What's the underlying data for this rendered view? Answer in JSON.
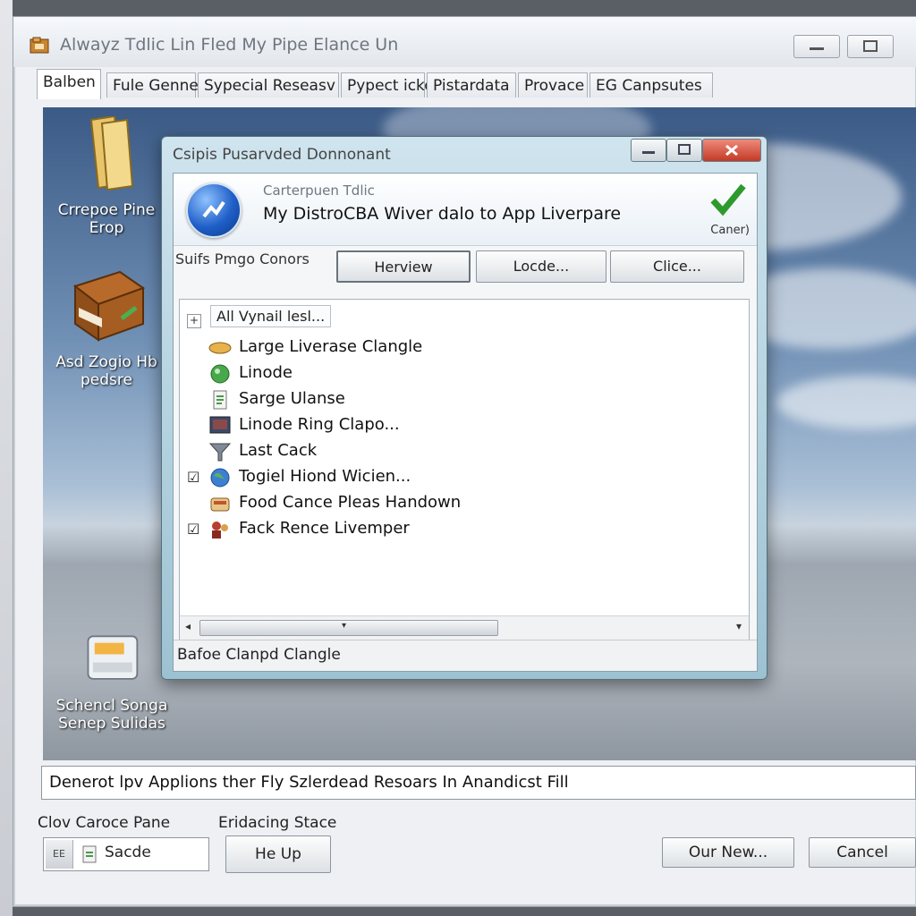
{
  "window": {
    "title": "Alwayz Tdlic Lin Fled My Pipe Elance Un",
    "tabs": [
      {
        "label": "Balben"
      },
      {
        "label": "Fule Genner"
      },
      {
        "label": "Sypecial Reseasv"
      },
      {
        "label": "Pypect icke"
      },
      {
        "label": "Pistardata"
      },
      {
        "label": "Provace"
      },
      {
        "label": "EG Canpsutes"
      }
    ]
  },
  "desktop": {
    "icons": [
      {
        "label": "Crrepoe Pine Erop"
      },
      {
        "label": "Asd Zogio Hb pedsre"
      },
      {
        "label": "Schencl Songa Senep Sulidas"
      }
    ]
  },
  "dialog": {
    "title": "Csipis Pusarvded Donnonant",
    "banner_subtitle": "Carterpuen Tdlic",
    "banner_title": "My DistroCBA Wiver dalo to App Liverpare",
    "connect_label": "Caner)",
    "section_label": "Suifs Pmgo Conors",
    "buttons": {
      "preview": "Herview",
      "locate": "Locde...",
      "close": "Clice..."
    },
    "tree_root": "All Vynail lesl...",
    "tree_expander": "+",
    "items": [
      {
        "label": "Large Liverase Clangle",
        "checked": false
      },
      {
        "label": "Linode",
        "checked": false
      },
      {
        "label": "Sarge Ulanse",
        "checked": false
      },
      {
        "label": "Linode Ring Clapo...",
        "checked": false
      },
      {
        "label": "Last Cack",
        "checked": false
      },
      {
        "label": "Togiel Hiond Wicien...",
        "checked": true
      },
      {
        "label": "Food Cance Pleas Handown",
        "checked": false
      },
      {
        "label": "Fack Rence Livemper",
        "checked": true
      }
    ],
    "status": "Bafoe Clanpd Clangle"
  },
  "bottom": {
    "description": "Denerot lpv Applions ther Fly Szlerdead Resoars In Anandicst Fill",
    "left_label": "Clov Caroce Pane",
    "mid_label": "Eridacing Stace",
    "field_prefix": "EE",
    "field_value": "Sacde",
    "helpup_button": "He Up",
    "ok_button": "Our New...",
    "cancel_button": "Cancel"
  }
}
